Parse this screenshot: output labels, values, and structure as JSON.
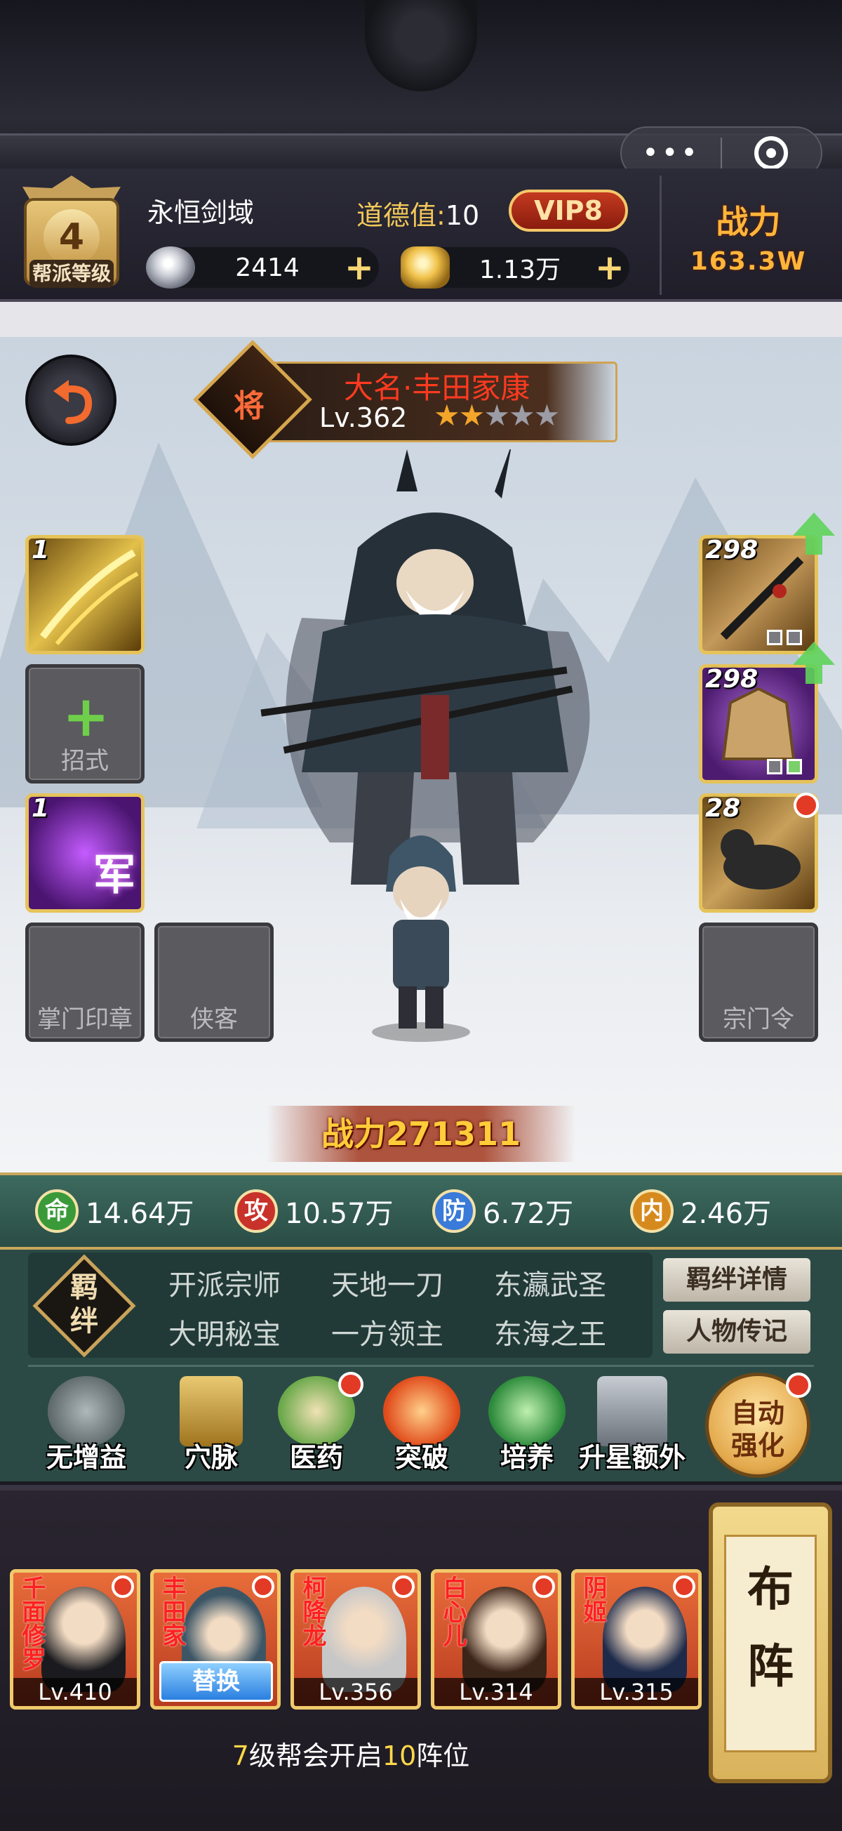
{
  "header": {
    "guild_level": "4",
    "guild_level_caption": "帮派等级",
    "guild_name": "永恒剑域",
    "morality_label": "道德值:",
    "morality_value": "10",
    "vip": "VIP8",
    "silver": "2414",
    "gold": "1.13万",
    "power_label": "战力",
    "power_value": "163.3W"
  },
  "hero": {
    "badge": "将",
    "name": "大名·丰田家康",
    "level": "Lv.362",
    "stars_filled": 2,
    "stars_total": 5,
    "power": "战力271311"
  },
  "left_slots": [
    {
      "count": "1",
      "type": "skill"
    },
    {
      "label": "招式",
      "type": "empty-add"
    },
    {
      "count": "1",
      "type": "army",
      "tag": "军"
    },
    {
      "label": "掌门印章",
      "type": "empty"
    }
  ],
  "extra_slot": {
    "label": "侠客"
  },
  "right_slots": [
    {
      "count": "298",
      "type": "weapon"
    },
    {
      "count": "298",
      "type": "armor"
    },
    {
      "count": "28",
      "type": "mount"
    },
    {
      "label": "宗门令",
      "type": "empty"
    }
  ],
  "stats": [
    {
      "badge": "命",
      "value": "14.64万",
      "color": "#3a9a3a"
    },
    {
      "badge": "攻",
      "value": "10.57万",
      "color": "#c8322a"
    },
    {
      "badge": "防",
      "value": "6.72万",
      "color": "#3a7ad8"
    },
    {
      "badge": "内",
      "value": "2.46万",
      "color": "#d68a1e"
    }
  ],
  "bonds": {
    "badge": "羁绊",
    "items": [
      "开派宗师",
      "天地一刀",
      "东瀛武圣",
      "大明秘宝",
      "一方领主",
      "东海之王"
    ],
    "detail_button": "羁绊详情",
    "bio_button": "人物传记"
  },
  "functions": [
    {
      "label": "无增益",
      "icon": "flame-icon"
    },
    {
      "label": "穴脉",
      "icon": "book-icon"
    },
    {
      "label": "医药",
      "icon": "herb-icon"
    },
    {
      "label": "突破",
      "icon": "breakthrough-icon"
    },
    {
      "label": "培养",
      "icon": "cultivate-icon"
    },
    {
      "label": "升星额外",
      "icon": "chest-icon"
    }
  ],
  "auto_button": "自动强化",
  "lineup": [
    {
      "name": "千面修罗",
      "level": "Lv.410"
    },
    {
      "name": "丰田家",
      "level": "",
      "swap": "替换"
    },
    {
      "name": "柯降龙",
      "level": "Lv.356"
    },
    {
      "name": "白心儿",
      "level": "Lv.314"
    },
    {
      "name": "阴姬",
      "level": "Lv.315"
    }
  ],
  "formation_button": "布阵",
  "hint": {
    "pre": "7",
    "mid": "级帮会开启",
    "num": "10",
    "post": "阵位"
  }
}
